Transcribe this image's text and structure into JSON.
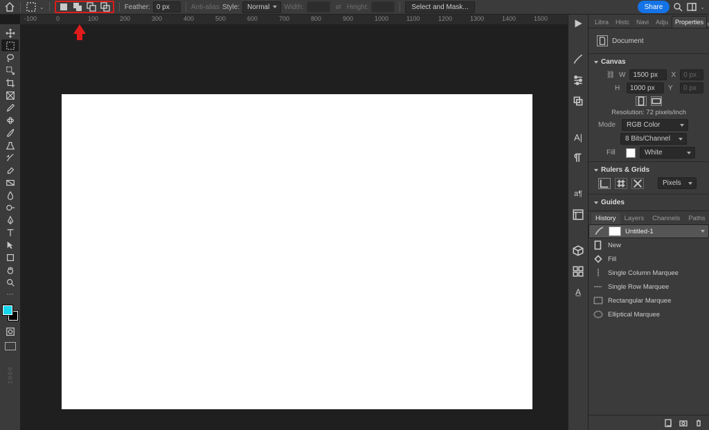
{
  "topbar": {
    "feather_label": "Feather:",
    "feather_value": "0 px",
    "antialias": "Anti-alias",
    "style_label": "Style:",
    "style_value": "Normal",
    "width_label": "Width:",
    "height_label": "Height:",
    "select_and_mask": "Select and Mask...",
    "share": "Share"
  },
  "ruler": [
    "-100",
    "0",
    "100",
    "200",
    "300",
    "400",
    "500",
    "600",
    "700",
    "800",
    "900",
    "1000",
    "1100",
    "1200",
    "1300",
    "1400",
    "1500"
  ],
  "right_tabs": [
    "Libra",
    "Histc",
    "Navi",
    "Adju",
    "Properties"
  ],
  "properties": {
    "doc_label": "Document",
    "canvas_head": "Canvas",
    "w": "W",
    "w_val": "1500 px",
    "x": "X",
    "x_val": "0 px",
    "h": "H",
    "h_val": "1000 px",
    "y": "Y",
    "y_val": "0 px",
    "resolution": "Resolution: 72 pixels/inch",
    "mode_label": "Mode",
    "mode_value": "RGB Color",
    "bits_value": "8 Bits/Channel",
    "fill_label": "Fill",
    "fill_value": "White",
    "rulers_head": "Rulers & Grids",
    "rulers_unit": "Pixels",
    "guides_head": "Guides"
  },
  "history_tabs": [
    "History",
    "Layers",
    "Channels",
    "Paths"
  ],
  "history": [
    {
      "label": "Untitled-1",
      "selected": true,
      "thumb": true
    },
    {
      "label": "New"
    },
    {
      "label": "Fill"
    },
    {
      "label": "Single Column Marquee"
    },
    {
      "label": "Single Row Marquee"
    },
    {
      "label": "Rectangular Marquee"
    },
    {
      "label": "Elliptical Marquee"
    }
  ]
}
